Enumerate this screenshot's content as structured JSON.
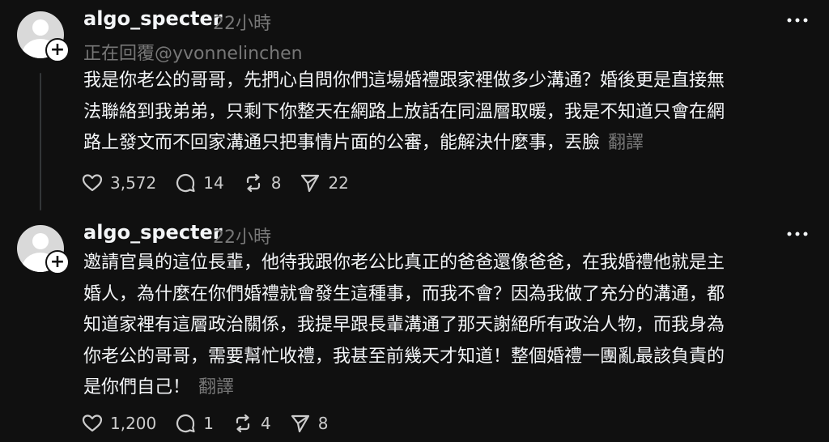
{
  "posts": [
    {
      "username": "algo_specter",
      "time": "22小時",
      "replying_to": "正在回覆@yvonnelinchen",
      "text": "我是你老公的哥哥，先捫心自問你們這場婚禮跟家裡做多少溝通？婚後更是直接無\n法聯絡到我弟弟，只剩下你整天在網路上放話在同溫層取暖，我是不知道只會在網\n路上發文而不回家溝通只把事情片面的公審，能解決什麼事，丟臉",
      "translate_label": "翻譯",
      "likes": "3,572",
      "replies": "14",
      "reposts": "8",
      "shares": "22"
    },
    {
      "username": "algo_specter",
      "time": "22小時",
      "text": "邀請官員的這位長輩，他待我跟你老公比真正的爸爸還像爸爸，在我婚禮他就是主\n婚人，為什麼在你們婚禮就會發生這種事，而我不會？因為我做了充分的溝通，都\n知道家裡有這層政治關係，我提早跟長輩溝通了那天謝絕所有政治人物，而我身為\n你老公的哥哥，需要幫忙收禮，我甚至前幾天才知道！整個婚禮一團亂最該負責的\n是你們自己！",
      "translate_label": "翻譯",
      "likes": "1,200",
      "replies": "1",
      "reposts": "4",
      "shares": "8"
    }
  ],
  "icons": {
    "like": "heart-icon",
    "reply": "comment-icon",
    "repost": "repost-icon",
    "share": "share-icon",
    "more": "more-icon",
    "follow": "plus-icon"
  }
}
